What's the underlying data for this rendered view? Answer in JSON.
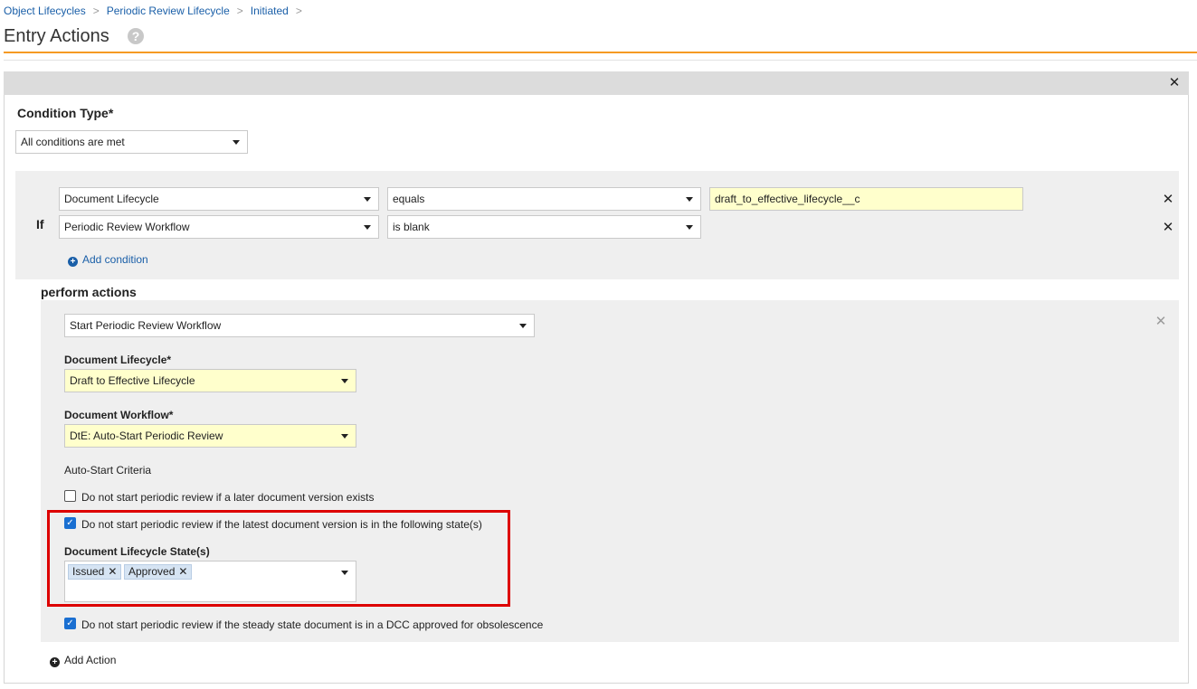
{
  "breadcrumb": [
    "Object Lifecycles",
    "Periodic Review Lifecycle",
    "Initiated"
  ],
  "breadcrumb_separator": ">",
  "title": "Entry Actions",
  "help_icon": "?",
  "close_glyph": "✕",
  "condition_type": {
    "label": "Condition Type*",
    "value": "All conditions are met"
  },
  "conditions": {
    "if_label": "If",
    "rows": [
      {
        "field": "Document Lifecycle",
        "operator": "equals",
        "value": "draft_to_effective_lifecycle__c"
      },
      {
        "field": "Periodic Review Workflow",
        "operator": "is blank",
        "value": ""
      }
    ],
    "add_label": "Add condition"
  },
  "actions": {
    "heading": "perform actions",
    "action_type": "Start Periodic Review Workflow",
    "lifecycle_label": "Document Lifecycle*",
    "lifecycle_value": "Draft to Effective Lifecycle",
    "workflow_label": "Document Workflow*",
    "workflow_value": "DtE: Auto-Start Periodic Review",
    "criteria_label": "Auto-Start Criteria",
    "criteria": [
      {
        "label": "Do not start periodic review if a later document version exists",
        "checked": false
      },
      {
        "label": "Do not start periodic review if the latest document version is in the following state(s)",
        "checked": true
      },
      {
        "label": "Do not start periodic review if the steady state document is in a DCC approved for obsolescence",
        "checked": true
      }
    ],
    "states_label": "Document Lifecycle State(s)",
    "states": [
      "Issued",
      "Approved"
    ],
    "add_action_label": "Add Action"
  },
  "colors": {
    "accent": "#f59a23",
    "link": "#1a5fa8",
    "highlight": "#dd0000",
    "required_field": "#ffffcc",
    "checkbox": "#1a6fd1"
  }
}
